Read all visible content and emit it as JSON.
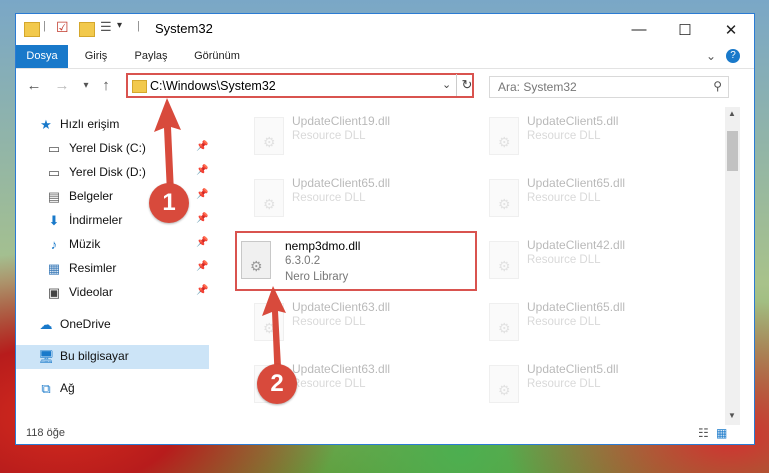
{
  "window": {
    "title": "System32"
  },
  "ribbon": {
    "tabs": [
      "Dosya",
      "Giriş",
      "Paylaş",
      "Görünüm"
    ],
    "active_tab": "Dosya"
  },
  "address": {
    "path": "C:\\Windows\\System32"
  },
  "search": {
    "placeholder": "Ara: System32"
  },
  "sidebar": {
    "items": [
      {
        "label": "Hızlı erişim",
        "icon": "star-icon"
      },
      {
        "label": "Yerel Disk (C:)",
        "icon": "drive-icon",
        "pinned": true
      },
      {
        "label": "Yerel Disk (D:)",
        "icon": "drive-icon",
        "pinned": true
      },
      {
        "label": "Belgeler",
        "icon": "document-icon",
        "pinned": true
      },
      {
        "label": "İndirmeler",
        "icon": "download-icon",
        "pinned": true
      },
      {
        "label": "Müzik",
        "icon": "music-icon",
        "pinned": true
      },
      {
        "label": "Resimler",
        "icon": "pictures-icon",
        "pinned": true
      },
      {
        "label": "Videolar",
        "icon": "video-icon",
        "pinned": true
      },
      {
        "label": "OneDrive",
        "icon": "cloud-icon"
      },
      {
        "label": "Bu bilgisayar",
        "icon": "computer-icon",
        "selected": true
      },
      {
        "label": "Ağ",
        "icon": "network-icon"
      }
    ]
  },
  "files": [
    {
      "name": "UpdateClient19.dll",
      "desc": "Resource DLL"
    },
    {
      "name": "UpdateClient5.dll",
      "desc": "Resource DLL"
    },
    {
      "name": "UpdateClient65.dll",
      "desc": "Resource DLL"
    },
    {
      "name": "UpdateClient65.dll",
      "desc": "Resource DLL"
    },
    {
      "name": "nemp3dmo.dll",
      "version": "6.3.0.2",
      "desc": "Nero Library",
      "highlighted": true
    },
    {
      "name": "UpdateClient42.dll",
      "desc": "Resource DLL"
    },
    {
      "name": "UpdateClient63.dll",
      "desc": "Resource DLL"
    },
    {
      "name": "UpdateClient65.dll",
      "desc": "Resource DLL"
    },
    {
      "name": "UpdateClient63.dll",
      "desc": "Resource DLL"
    },
    {
      "name": "UpdateClient5.dll",
      "desc": "Resource DLL"
    }
  ],
  "status": {
    "count": "118 öğe"
  },
  "callouts": [
    "1",
    "2"
  ],
  "colors": {
    "accent": "#1979ca",
    "highlight": "#d9534f",
    "callout": "#d84a3c"
  }
}
